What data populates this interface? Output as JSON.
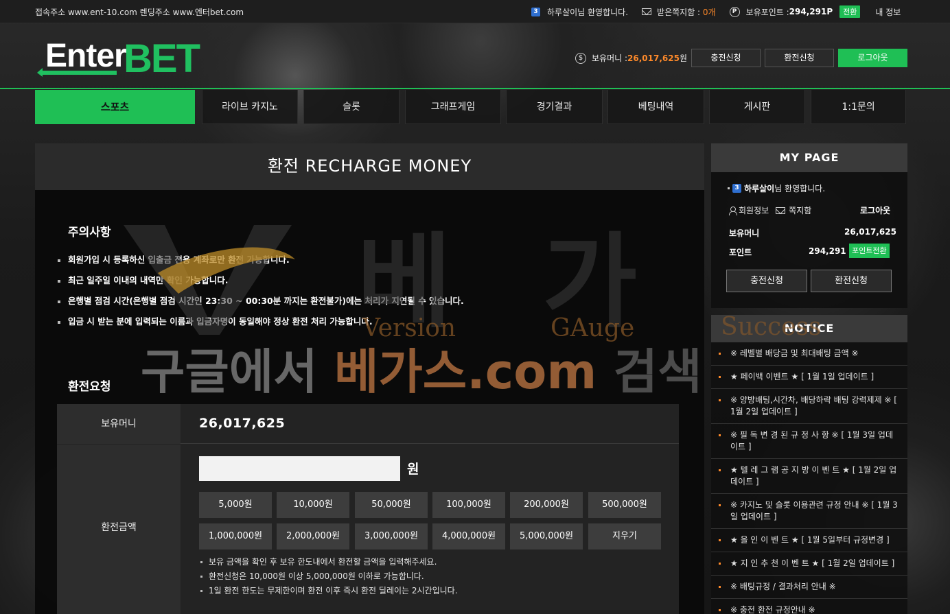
{
  "topbar": {
    "address": "접속주소 www.ent-10.com 렌딩주소 www.엔터bet.com",
    "level": "3",
    "greeting": "하루살이님 환영합니다.",
    "messages_label": "받은쪽지함 : ",
    "messages_count": "0개",
    "points_label": "보유포인트 : ",
    "points_value": "294,291P",
    "convert_label": "전환",
    "my_info": "내 정보"
  },
  "header": {
    "logo_enter": "Enter",
    "logo_bet": "BET",
    "money_label": "보유머니 : ",
    "money_value": "26,017,625",
    "money_unit": "원",
    "deposit_button": "충전신청",
    "withdraw_button": "환전신청",
    "logout_button": "로그아웃"
  },
  "nav": {
    "tabs": [
      "스포츠",
      "라이브 카지노",
      "슬롯",
      "그래프게임",
      "경기결과",
      "베팅내역",
      "게시판",
      "1:1문의"
    ]
  },
  "main": {
    "title": "환전 RECHARGE MONEY",
    "notice_heading": "주의사항",
    "rules": [
      "회원가입 시 등록하신 입출금 전용 계좌로만 환전 가능합니다.",
      "최근 일주일 이내의 내역만 확인 가능합니다.",
      "은행별 점검 시간(은행별 점검 시간인 23:30 ~ 00:30분 까지는 환전불가)에는 처리가 지연될 수 있습니다.",
      "입금 시 받는 분에 입력되는 이름과 입금자명이 동일해야 정상 환전 처리 가능합니다."
    ],
    "request_heading": "환전요청",
    "balance_label": "보유머니",
    "balance_value": "26,017,625",
    "amount_label": "환전금액",
    "amount_value": "",
    "amount_unit": "원",
    "chips": [
      "5,000원",
      "10,000원",
      "50,000원",
      "100,000원",
      "200,000원",
      "500,000원",
      "1,000,000원",
      "2,000,000원",
      "3,000,000원",
      "4,000,000원",
      "5,000,000원",
      "지우기"
    ],
    "tips": [
      "보유 금액을 확인 후 보유 한도내에서 환전할 금액을 입력해주세요.",
      "환전신청은 10,000원 이상 5,000,000원 이하로 가능합니다.",
      "1일 환전 한도는 무제한이며 환전 이후 즉시 환전 딜레이는 2시간입니다."
    ]
  },
  "mypage": {
    "title": "MY PAGE",
    "level": "3",
    "user": "하루살이",
    "greeting_suffix": "님 환영합니다.",
    "member_info": "회원정보",
    "messages": "쪽지함",
    "logout": "로그아웃",
    "money_label": "보유머니",
    "money_value": "26,017,625",
    "points_label": "포인트",
    "points_value": "294,291",
    "convert_button": "포인트전환",
    "deposit_button": "충전신청",
    "withdraw_button": "환전신청"
  },
  "notice": {
    "title": "NOTICE",
    "items": [
      "※ 레벨별 배당금 및 최대배팅 금액 ※",
      "★ 페이백 이벤트 ★ [ 1월 1일 업데이트 ]",
      "※ 양방배팅,시간차, 배당하락 배팅 강력제제 ※ [ 1월 2일 업데이트 ]",
      "※ 필 독 변 경 된 규 정 사 항 ※ [ 1월 3일 업데이트 ]",
      "★ 텔 레 그 램 공 지 방 이 벤 트 ★ [ 1월 2일 업데이트 ]",
      "※ 카지노 및 슬롯 이용관련 규정 안내 ※ [ 1월 3일 업데이트 ]",
      "★ 올 인 이 벤 트 ★ [ 1월 5일부터 규정변경 ]",
      "★ 지 인 추 천 이 벤 트 ★ [ 1월 2일 업데이트 ]",
      "※ 배팅규정 / 결과처리 안내 ※",
      "※ 충전 환전 규정안내 ※"
    ]
  },
  "watermark": {
    "hangul": "베 가",
    "version": "Version",
    "gauge": "GAuge",
    "success": "Success",
    "line_a": "구글에서 ",
    "line_b": "베가스.com",
    "line_c": " 검색"
  },
  "colors": {
    "accent": "#1fbf55",
    "money": "#ff8a2a",
    "watermark_brown": "#a0643a"
  }
}
